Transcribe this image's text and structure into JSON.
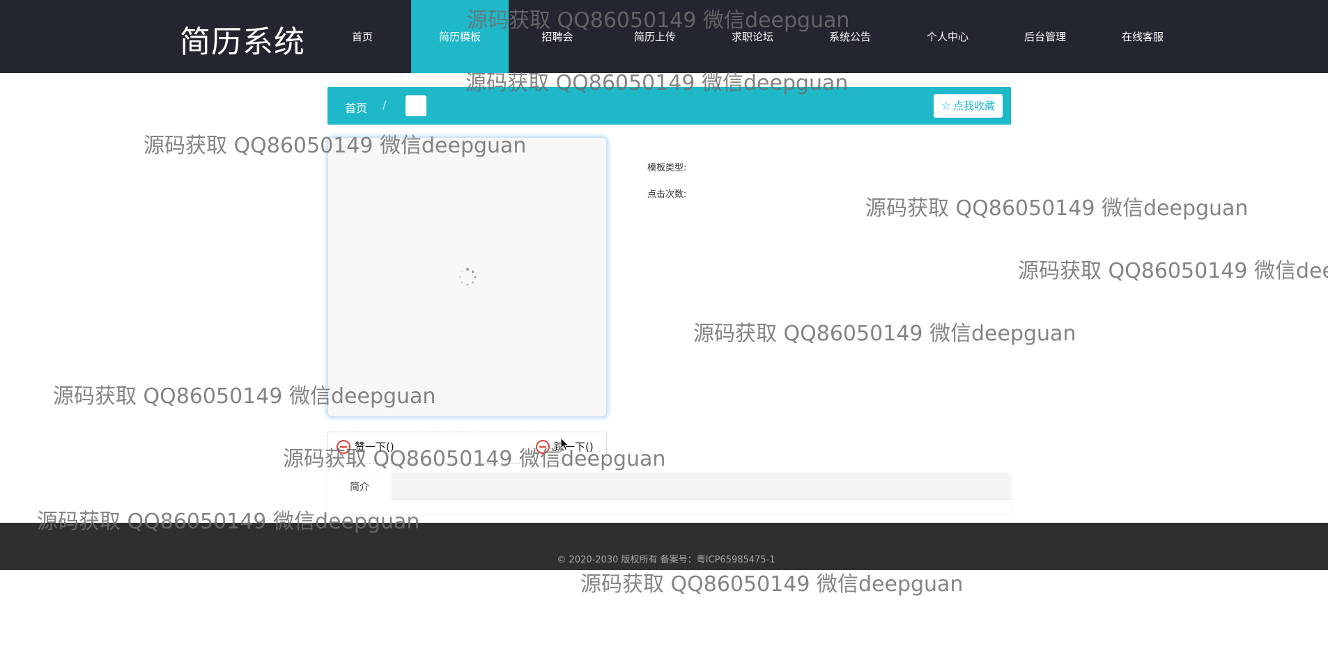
{
  "header": {
    "logo": "简历系统",
    "nav": [
      {
        "label": "首页",
        "active": false
      },
      {
        "label": "简历模板",
        "active": true
      },
      {
        "label": "招聘会",
        "active": false
      },
      {
        "label": "简历上传",
        "active": false
      },
      {
        "label": "求职论坛",
        "active": false
      },
      {
        "label": "系统公告",
        "active": false
      },
      {
        "label": "个人中心",
        "active": false
      },
      {
        "label": "后台管理",
        "active": false
      },
      {
        "label": "在线客服",
        "active": false
      }
    ]
  },
  "breadcrumb": {
    "home": "首页",
    "separator": "/",
    "current": ""
  },
  "favorite": {
    "icon": "star-icon",
    "label": "点我收藏"
  },
  "details": {
    "type_label": "模板类型:",
    "clicks_label": "点击次数:"
  },
  "votes": {
    "up_label": "赞一下()",
    "down_label": "踩一下()"
  },
  "tabs": {
    "intro_label": "简介"
  },
  "footer": {
    "copyright": "© 2020-2030 版权所有 备案号：粤ICP65985475-1"
  },
  "watermark": {
    "text": "源码获取 QQ86050149 微信deepguan"
  },
  "colors": {
    "header_bg": "#23262e",
    "accent": "#1fb8c9",
    "footer_bg": "#2f2f2f"
  }
}
